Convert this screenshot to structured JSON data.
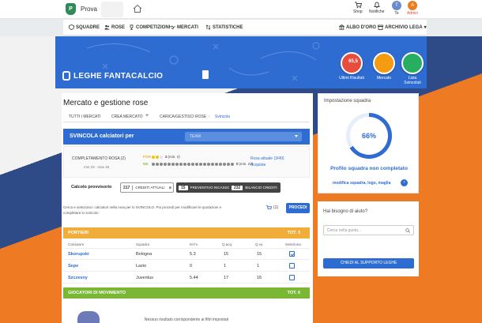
{
  "topbar": {
    "logo_letter": "P",
    "league_name": "Prova",
    "shop_label": "Shop",
    "notifiche_label": "Notifiche",
    "user_label": "Te",
    "user_initial": "T",
    "admin_label": "Admin",
    "admin_initial": "A"
  },
  "nav": {
    "squadre": "SQUADRE",
    "rose": "ROSE",
    "competizioni": "COMPETIZIONI",
    "mercati": "MERCATI",
    "statistiche": "STATISTICHE",
    "albo": "ALBO D'ORO",
    "archivio": "ARCHIVIO LEGA"
  },
  "banner": {
    "brand": "LEGHE FANTACALCIO",
    "badges": [
      {
        "value": "65,5",
        "label": "Ultimi Risultati",
        "color": "#e74c3c"
      },
      {
        "value": "",
        "label": "Mercato",
        "color": "#f39c12"
      },
      {
        "value": "",
        "label": "Lista Svincolati",
        "color": "#27ae60"
      }
    ]
  },
  "main": {
    "title": "Mercato e gestione rose",
    "tabs": [
      "TUTTI I MERCATI",
      "CREA MERCATO",
      "CARICA/GESTISCI ROSE",
      "Svincola"
    ],
    "svincola_title": "SVINCOLA calciatori per",
    "team_select": "TEAM",
    "completamento_label": "COMPLETAMENTO ROSA (2)",
    "completamento_sub": "min 23 - max 40",
    "por_label": "POR",
    "por_value": "2",
    "por_min": "(min. 2)",
    "gk_label": "GK",
    "gk_value": "0",
    "gk_min": "(min. 21)",
    "rosa_attuale": "Rosa attuale (3/40)",
    "acquista": "Acquista",
    "calcolo_label": "Calcolo provvisorio",
    "crediti_attuali_val": "217",
    "crediti_attuali_label": "CREDITI ATTUALI",
    "preventivo_val": "15",
    "preventivo_label": "PREVENTIVO INCASSO",
    "bilancio_val": "232",
    "bilancio_label": "BILANCIO CREDITI",
    "info_text": "Cerca e seleziona i calciatori nella rosa per lo SVINCOLO. Poi procedi per modificare le quotazioni e completare lo svincolo",
    "cart_count": "(1)",
    "procedi": "PROCEDI",
    "portieri_label": "PORTIERI",
    "portieri_tot": "TOT. 3",
    "columns": [
      "Calciatore",
      "Squadra",
      "M.Fv.",
      "Q.acq.",
      "Q.vs.",
      "Seleziona"
    ],
    "rows": [
      {
        "name": "Skorupski",
        "team": "Bologna",
        "mfv": "5.3",
        "qacq": "15",
        "qvs": "15",
        "selected": true
      },
      {
        "name": "Sepe",
        "team": "Lazio",
        "mfv": "0",
        "qacq": "1",
        "qvs": "1",
        "selected": false
      },
      {
        "name": "Szczesny",
        "team": "Juventus",
        "mfv": "5.44",
        "qacq": "17",
        "qvs": "16",
        "selected": false
      }
    ],
    "movimento_label": "GIOCATORI DI MOVIMENTO",
    "movimento_tot": "TOT. 0",
    "empty_text": "Nessun risultato corrispondente ai filtri impostati"
  },
  "side": {
    "impostazione_title": "Impostazione squadra",
    "percent_value": 66,
    "percent_label": "66%",
    "not_complete": "Profilo squadra non completato",
    "modifica_link": "modifica squadra, logo, maglia",
    "help_title": "Hai bisogno di aiuto?",
    "search_placeholder": "Cerca nella guida...",
    "chiedi_button": "CHIEDI AL SUPPORTO LEGHE"
  }
}
